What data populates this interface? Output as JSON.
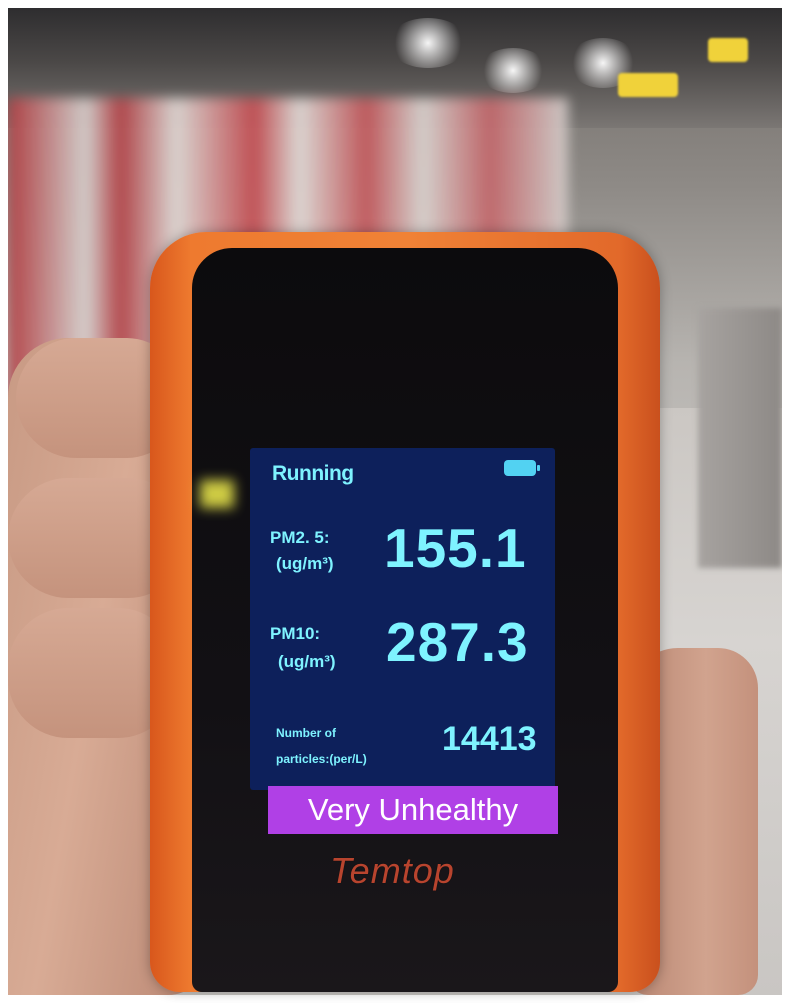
{
  "device": {
    "status": "Running",
    "pm25_label_line1": "PM2. 5:",
    "pm25_unit": "(ug/m³)",
    "pm25_value": "155.1",
    "pm10_label_line1": "PM10:",
    "pm10_unit": "(ug/m³)",
    "pm10_value": "287.3",
    "particles_label_line1": "Number of",
    "particles_label_line2": "particles:(per/L)",
    "particles_value": "14413",
    "air_quality": "Very Unhealthy",
    "brand": "Temtop"
  },
  "colors": {
    "device_body": "#f08236",
    "screen_background": "#0d205b",
    "screen_text": "#7ef3ff",
    "banner_background": "#b040e6"
  },
  "icons": {
    "battery": "battery-icon"
  }
}
